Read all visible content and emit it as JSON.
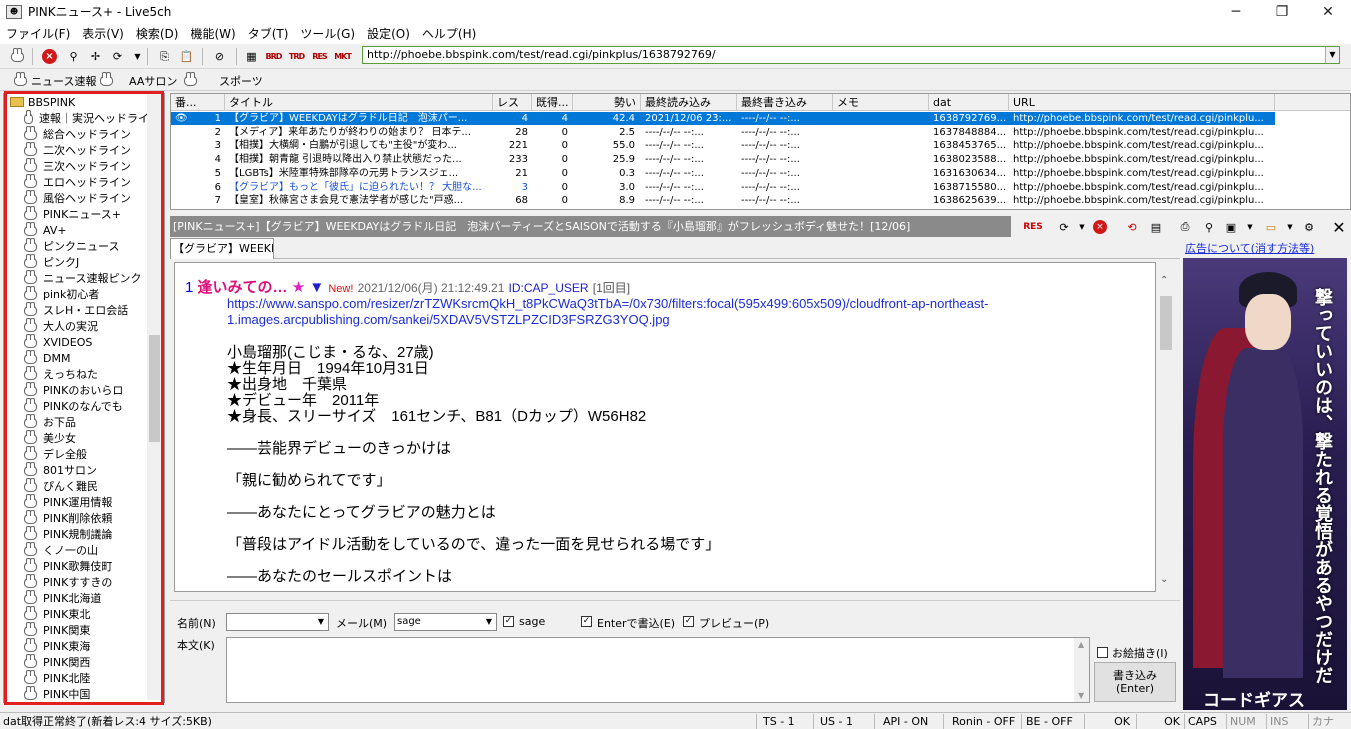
{
  "window": {
    "title": "PINKニュース+ - Live5ch"
  },
  "menu": [
    "ファイル(F)",
    "表示(V)",
    "検索(D)",
    "機能(W)",
    "タブ(T)",
    "ツール(G)",
    "設定(O)",
    "ヘルプ(H)"
  ],
  "address": {
    "url": "http://phoebe.bbspink.com/test/read.cgi/pinkplus/1638792769/"
  },
  "favorites": [
    "ニュース速報",
    "AAサロン",
    "スポーツ"
  ],
  "tree": {
    "root": "BBSPINK",
    "items": [
      "速報｜実況ヘッドライ",
      "総合ヘッドライン",
      "二次ヘッドライン",
      "三次ヘッドライン",
      "エロヘッドライン",
      "風俗ヘッドライン",
      "PINKニュース+",
      "AV+",
      "ピンクニュース",
      "ピンクJ",
      "ニュース速報ピンク",
      "pink初心者",
      "スレH・エロ会話",
      "大人の実況",
      "XVIDEOS",
      "DMM",
      "えっちねた",
      "PINKのおいらロ",
      "PINKのなんでも",
      "お下品",
      "美少女",
      "デレ全般",
      "801サロン",
      "ぴんく難民",
      "PINK運用情報",
      "PINK削除依頼",
      "PINK規制議論",
      "くノ一の山",
      "PINK歌舞伎町",
      "PINKすすきの",
      "PINK北海道",
      "PINK東北",
      "PINK関東",
      "PINK東海",
      "PINK関西",
      "PINK北陸",
      "PINK中国"
    ]
  },
  "list": {
    "headers": [
      "番...",
      "タイトル",
      "レス",
      "既得...",
      "勢い",
      "最終読み込み",
      "最終書き込み",
      "メモ",
      "dat",
      "URL"
    ],
    "rows": [
      {
        "num": "1",
        "title": "【グラビア】WEEKDAYはグラドル日記　泡沫パー...",
        "res": "4",
        "got": "4",
        "mom": "42.4",
        "read": "2021/12/06 23:...",
        "write": "----/--/-- --:...",
        "dat": "1638792769....",
        "url": "http://phoebe.bbspink.com/test/read.cgi/pinkplu...",
        "blue": false
      },
      {
        "num": "2",
        "title": "【メディア】来年あたりが終わりの始まり？ 日本テ...",
        "res": "28",
        "got": "0",
        "mom": "2.5",
        "read": "----/--/-- --:...",
        "write": "----/--/-- --:...",
        "dat": "1637848884....",
        "url": "http://phoebe.bbspink.com/test/read.cgi/pinkplu...",
        "blue": false
      },
      {
        "num": "3",
        "title": "【相撲】大横綱・白鵬が引退しても\"主役\"が変わ...",
        "res": "221",
        "got": "0",
        "mom": "55.0",
        "read": "----/--/-- --:...",
        "write": "----/--/-- --:...",
        "dat": "1638453765....",
        "url": "http://phoebe.bbspink.com/test/read.cgi/pinkplu...",
        "blue": false
      },
      {
        "num": "4",
        "title": "【相撲】朝青龍 引退時以降出入り禁止状態だった...",
        "res": "233",
        "got": "0",
        "mom": "25.9",
        "read": "----/--/-- --:...",
        "write": "----/--/-- --:...",
        "dat": "1638023588....",
        "url": "http://phoebe.bbspink.com/test/read.cgi/pinkplu...",
        "blue": false
      },
      {
        "num": "5",
        "title": "【LGBTs】米陸軍特殊部隊卒の元男トランスジェ...",
        "res": "21",
        "got": "0",
        "mom": "0.3",
        "read": "----/--/-- --:...",
        "write": "----/--/-- --:...",
        "dat": "1631630634....",
        "url": "http://phoebe.bbspink.com/test/read.cgi/pinkplu...",
        "blue": false
      },
      {
        "num": "6",
        "title": "【グラビア】もっと「彼氏」に迫られたい！？ 大胆な...",
        "res": "3",
        "got": "0",
        "mom": "3.0",
        "read": "----/--/-- --:...",
        "write": "----/--/-- --:...",
        "dat": "1638715580....",
        "url": "http://phoebe.bbspink.com/test/read.cgi/pinkplu...",
        "blue": true
      },
      {
        "num": "7",
        "title": "【皇室】秋篠宮さま会見で憲法学者が感じた\"戸惑...",
        "res": "68",
        "got": "0",
        "mom": "8.9",
        "read": "----/--/-- --:...",
        "write": "----/--/-- --:...",
        "dat": "1638625639....",
        "url": "http://phoebe.bbspink.com/test/read.cgi/pinkplu...",
        "blue": false
      }
    ]
  },
  "thread": {
    "title": "[PINKニュース+]【グラビア】WEEKDAYはグラドル日記　泡沫パーティーズとSAISONで活動する『小島瑠那』がフレッシュボディ魅せた！[12/06]",
    "tab": "【グラビア】WEEKD",
    "res": {
      "num": "1",
      "name": "逢いみての…",
      "new": "New!",
      "date": "2021/12/06(月) 21:12:49.21",
      "id": "ID:CAP_USER",
      "count": "[1回目]",
      "url1": "https://www.sanspo.com/resizer/zrTZWKsrcmQkH_t8PkCWaQ3tTbA=/0x730/filters:focal(595x499:605x509)/cloudfront-ap-northeast-",
      "url2": "1.images.arcpublishing.com/sankei/5XDAV5VSTZLPZCID3FSRZG3YOQ.jpg",
      "lines": [
        "小島瑠那(こじま・るな、27歳)",
        "★生年月日　1994年10月31日",
        "★出身地　千葉県",
        "★デビュー年　2011年",
        "★身長、スリーサイズ　161センチ、B81（Dカップ）W56H82",
        "――芸能界デビューのきっかけは",
        "「親に勧められてです」",
        "――あなたにとってグラビアの魅力とは",
        "「普段はアイドル活動をしているので、違った一面を見せられる場です」",
        "――あなたのセールスポイントは"
      ]
    }
  },
  "ad": {
    "link": "広告について(消す方法等)",
    "vertical": "撃っていいのは、撃たれる覚悟があるやつだけだ",
    "logo": "コードギアス"
  },
  "post": {
    "name_label": "名前(N)",
    "mail_label": "メール(M)",
    "mail_value": "sage",
    "sage_label": "sage",
    "enter_label": "Enterで書込(E)",
    "preview_label": "プレビュー(P)",
    "body_label": "本文(K)",
    "oekaki_label": "お絵描き(I)",
    "submit_label": "書き込み\n(Enter)"
  },
  "status": [
    "dat取得正常終了(新着レス:4  サイズ:5KB)",
    "TS - 1",
    "US - 1",
    "API - ON",
    "Ronin - OFF",
    "BE - OFF",
    "OK",
    "OK",
    "CAPS",
    "NUM",
    "INS",
    "カナ"
  ]
}
